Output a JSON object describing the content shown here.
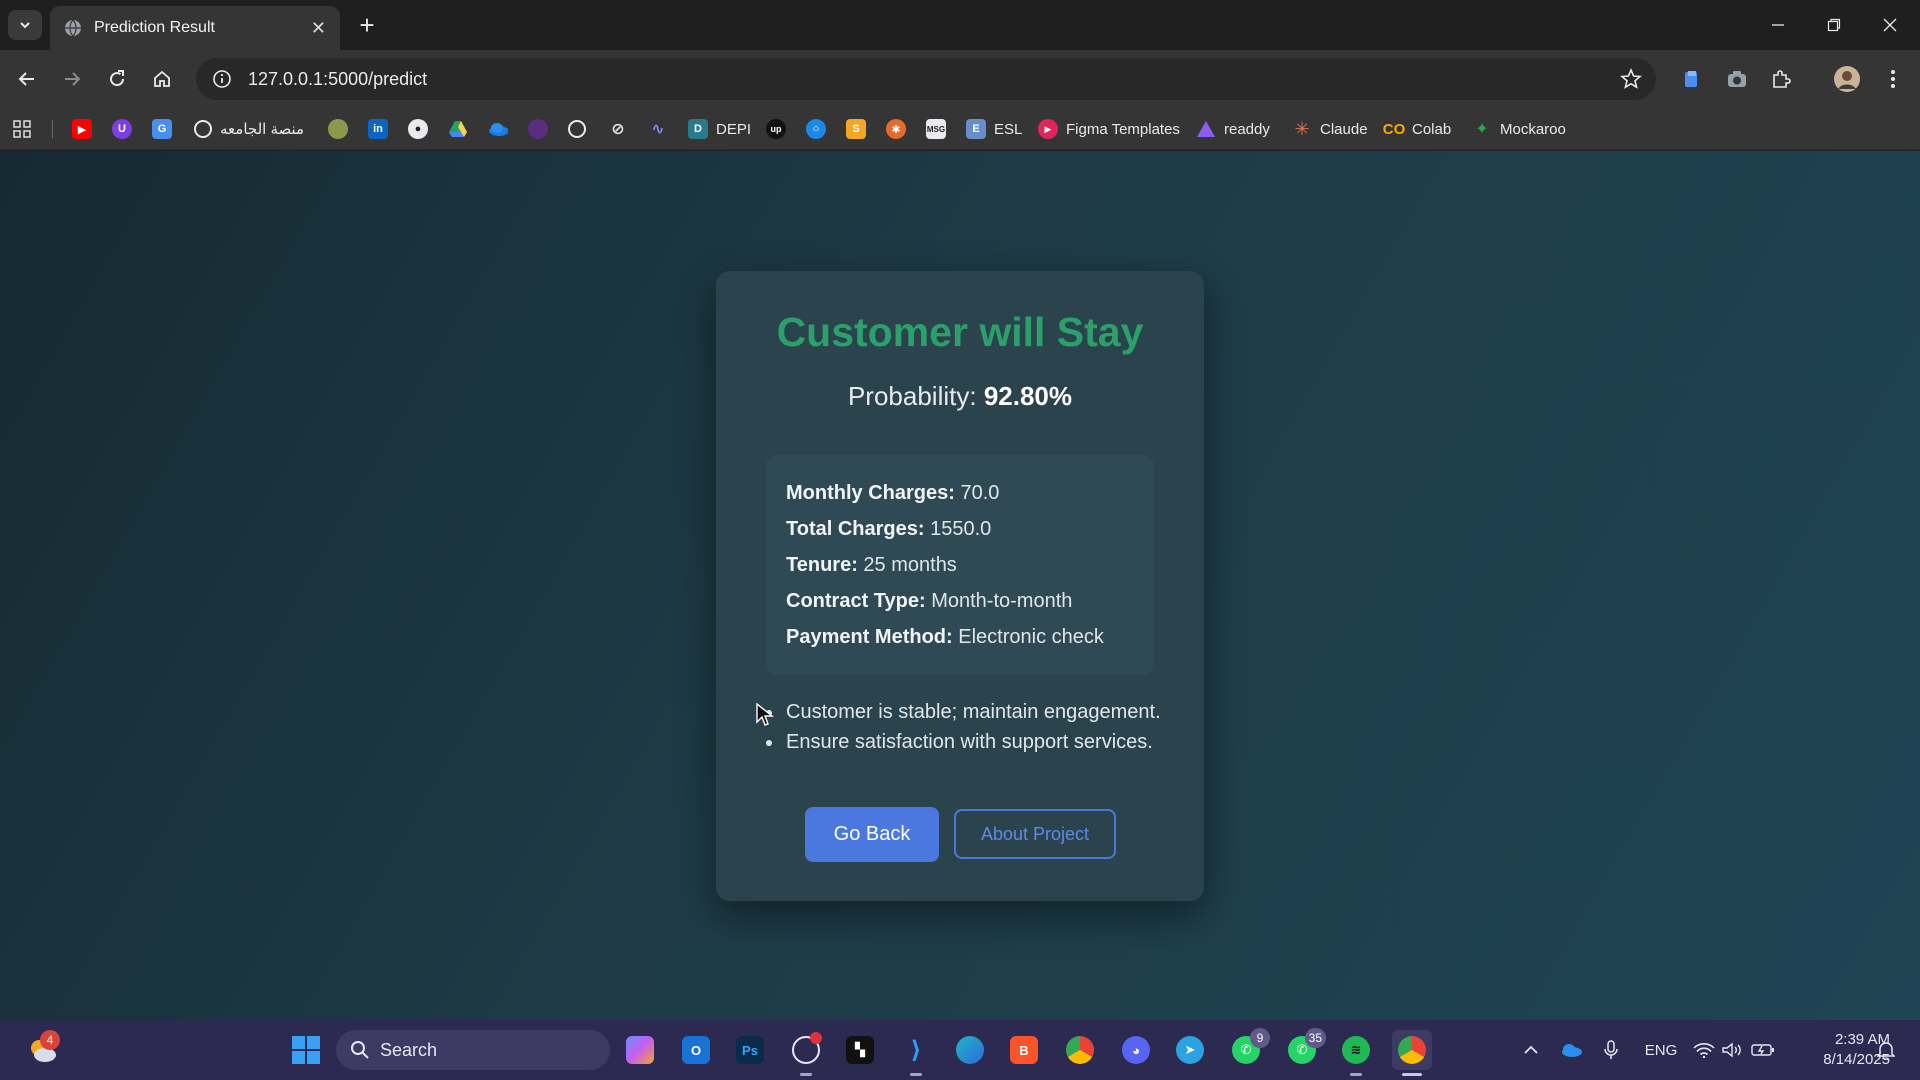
{
  "browser": {
    "tab_title": "Prediction Result",
    "url": "127.0.0.1:5000/predict",
    "bookmarks": [
      {
        "label": "",
        "icon": "youtube-icon"
      },
      {
        "label": "",
        "icon": "purple-app-icon"
      },
      {
        "label": "",
        "icon": "translate-icon"
      },
      {
        "label": "منصة الجامعه",
        "icon": "globe-icon"
      },
      {
        "label": "",
        "icon": "seal-icon"
      },
      {
        "label": "",
        "icon": "linkedin-icon"
      },
      {
        "label": "",
        "icon": "github-icon"
      },
      {
        "label": "",
        "icon": "drive-icon"
      },
      {
        "label": "",
        "icon": "onedrive-icon"
      },
      {
        "label": "",
        "icon": "grape-icon"
      },
      {
        "label": "",
        "icon": "openai-icon"
      },
      {
        "label": "",
        "icon": "slash-icon"
      },
      {
        "label": "",
        "icon": "wave-icon"
      },
      {
        "label": "DEPI",
        "icon": "depi-icon"
      },
      {
        "label": "",
        "icon": "upwork-icon"
      },
      {
        "label": "",
        "icon": "circle-blue-icon"
      },
      {
        "label": "",
        "icon": "orange-s-icon"
      },
      {
        "label": "",
        "icon": "orange-flower-icon"
      },
      {
        "label": "",
        "icon": "msg-icon"
      },
      {
        "label": "ESL",
        "icon": "esl-icon"
      },
      {
        "label": "Figma Templates",
        "icon": "play-red-icon"
      },
      {
        "label": "readdy",
        "icon": "readdy-icon"
      },
      {
        "label": "Claude",
        "icon": "claude-icon"
      },
      {
        "label": "Colab",
        "icon": "colab-icon"
      },
      {
        "label": "Mockaroo",
        "icon": "mockaroo-icon"
      }
    ]
  },
  "result": {
    "heading": "Customer will Stay",
    "probability_label": "Probability:",
    "probability_value": "92.80%",
    "details": [
      {
        "key": "Monthly Charges:",
        "value": "70.0"
      },
      {
        "key": "Total Charges:",
        "value": "1550.0"
      },
      {
        "key": "Tenure:",
        "value": "25 months"
      },
      {
        "key": "Contract Type:",
        "value": "Month-to-month"
      },
      {
        "key": "Payment Method:",
        "value": "Electronic check"
      }
    ],
    "recommendations": [
      "Customer is stable; maintain engagement.",
      "Ensure satisfaction with support services."
    ],
    "go_back_label": "Go Back",
    "about_label": "About Project",
    "heading_color": "#2aa06a",
    "accent_color": "#4a78df"
  },
  "taskbar": {
    "weather_badge": "4",
    "search_label": "Search",
    "whatsapp_badge": "9",
    "whatsapp2_badge": "35",
    "language": "ENG",
    "time": "2:39 AM",
    "date": "8/14/2025"
  }
}
